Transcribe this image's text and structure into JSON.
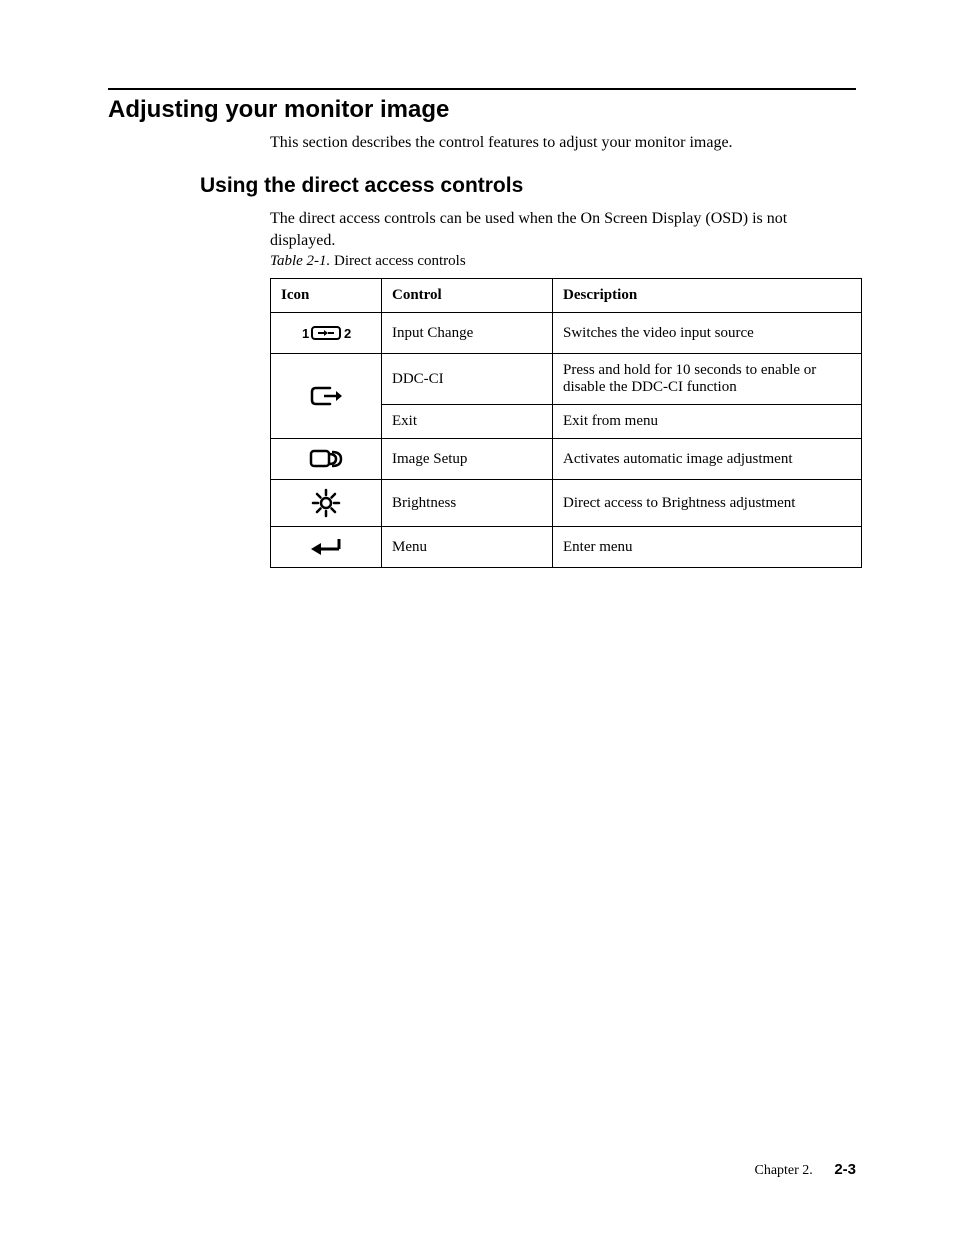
{
  "section": {
    "title": "Adjusting your monitor image",
    "intro": "This section describes the control features to adjust your monitor image."
  },
  "subsection": {
    "title": "Using the direct access controls",
    "intro": "The direct access controls can be used when the On Screen Display (OSD) is not displayed."
  },
  "table": {
    "caption_label": "Table 2-1.",
    "caption_text": " Direct access controls",
    "headers": {
      "icon": "Icon",
      "control": "Control",
      "description": "Description"
    },
    "rows": [
      {
        "icon": "input-change-icon",
        "control": "Input Change",
        "description": "Switches the video input source"
      },
      {
        "icon": "exit-icon",
        "control": "DDC-CI",
        "description": "Press and hold for 10 seconds to enable or disable the DDC-CI function"
      },
      {
        "icon": "exit-icon",
        "control": "Exit",
        "description": "Exit from menu"
      },
      {
        "icon": "image-setup-icon",
        "control": "Image Setup",
        "description": "Activates automatic image adjustment"
      },
      {
        "icon": "brightness-icon",
        "control": "Brightness",
        "description": "Direct access to Brightness adjustment"
      },
      {
        "icon": "menu-icon",
        "control": "Menu",
        "description": "Enter menu"
      }
    ]
  },
  "footer": {
    "chapter": "Chapter 2.",
    "page": "2-3"
  }
}
